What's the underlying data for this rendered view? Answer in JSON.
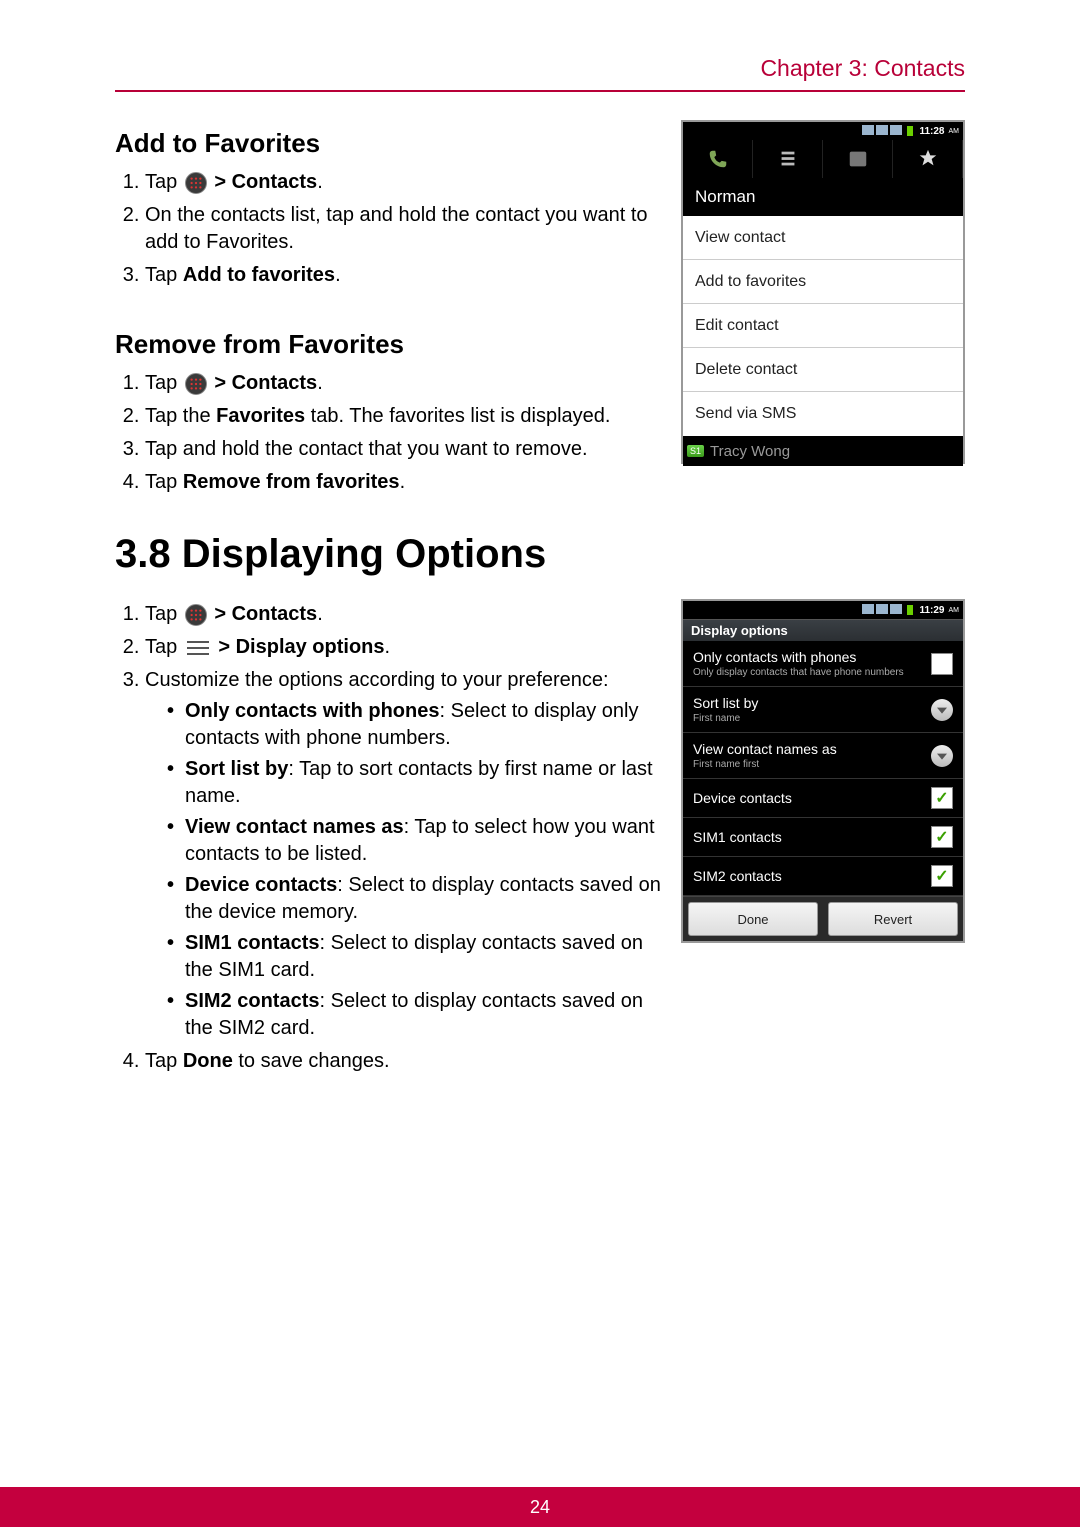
{
  "header": {
    "chapter": "Chapter 3: Contacts"
  },
  "footer": {
    "page": "24"
  },
  "section1": {
    "title": "Add to Favorites",
    "steps": {
      "s1_pre": "Tap ",
      "s1_post": " > Contacts",
      "s1_end": ".",
      "s2": "On the contacts list, tap and hold the contact you want to add to Favorites.",
      "s3_pre": "Tap ",
      "s3_bold": "Add to favorites",
      "s3_end": "."
    }
  },
  "section2": {
    "title": "Remove from Favorites",
    "steps": {
      "s1_pre": "Tap ",
      "s1_post": " > Contacts",
      "s1_end": ".",
      "s2_a": "Tap the ",
      "s2_bold": "Favorites",
      "s2_b": " tab. The favorites list is displayed.",
      "s3": "Tap and hold the contact that you want to remove.",
      "s4_pre": "Tap ",
      "s4_bold": "Remove from favorites",
      "s4_end": "."
    }
  },
  "section3": {
    "title": "3.8 Displaying Options",
    "steps": {
      "s1_pre": "Tap ",
      "s1_post": " > Contacts",
      "s1_end": ".",
      "s2_pre": "Tap ",
      "s2_post": " > Display options",
      "s2_end": ".",
      "s3": "Customize the options according to your preference:",
      "bul1_b": "Only contacts with phones",
      "bul1_t": ": Select to display only contacts with phone numbers.",
      "bul2_b": "Sort list by",
      "bul2_t": ": Tap to sort contacts by first name or last name.",
      "bul3_b": "View contact names as",
      "bul3_t": ": Tap to select how you want contacts to be listed.",
      "bul4_b": "Device contacts",
      "bul4_t": ": Select to display contacts saved on the device memory.",
      "bul5_b": "SIM1 contacts",
      "bul5_t": ": Select to display contacts saved on the SIM1 card.",
      "bul6_b": "SIM2 contacts",
      "bul6_t": ": Select to display contacts saved on the SIM2 card.",
      "s4_pre": "Tap ",
      "s4_bold": "Done",
      "s4_end": " to save changes."
    }
  },
  "shot1": {
    "time": "11:28",
    "ampm": "AM",
    "contactName": "Norman",
    "menu": [
      "View contact",
      "Add to favorites",
      "Edit contact",
      "Delete contact",
      "Send via SMS"
    ],
    "spillBadge": "S1",
    "spillName": "Tracy Wong"
  },
  "shot2": {
    "time": "11:29",
    "ampm": "AM",
    "header": "Display options",
    "items": [
      {
        "title": "Only contacts with phones",
        "sub": "Only display contacts that have phone numbers",
        "ctrl": "check",
        "on": false
      },
      {
        "title": "Sort list by",
        "sub": "First name",
        "ctrl": "radio"
      },
      {
        "title": "View contact names as",
        "sub": "First name first",
        "ctrl": "radio"
      },
      {
        "title": "Device contacts",
        "sub": "",
        "ctrl": "check",
        "on": true
      },
      {
        "title": "SIM1 contacts",
        "sub": "",
        "ctrl": "check",
        "on": true
      },
      {
        "title": "SIM2 contacts",
        "sub": "",
        "ctrl": "check",
        "on": true
      }
    ],
    "btnDone": "Done",
    "btnRevert": "Revert"
  }
}
